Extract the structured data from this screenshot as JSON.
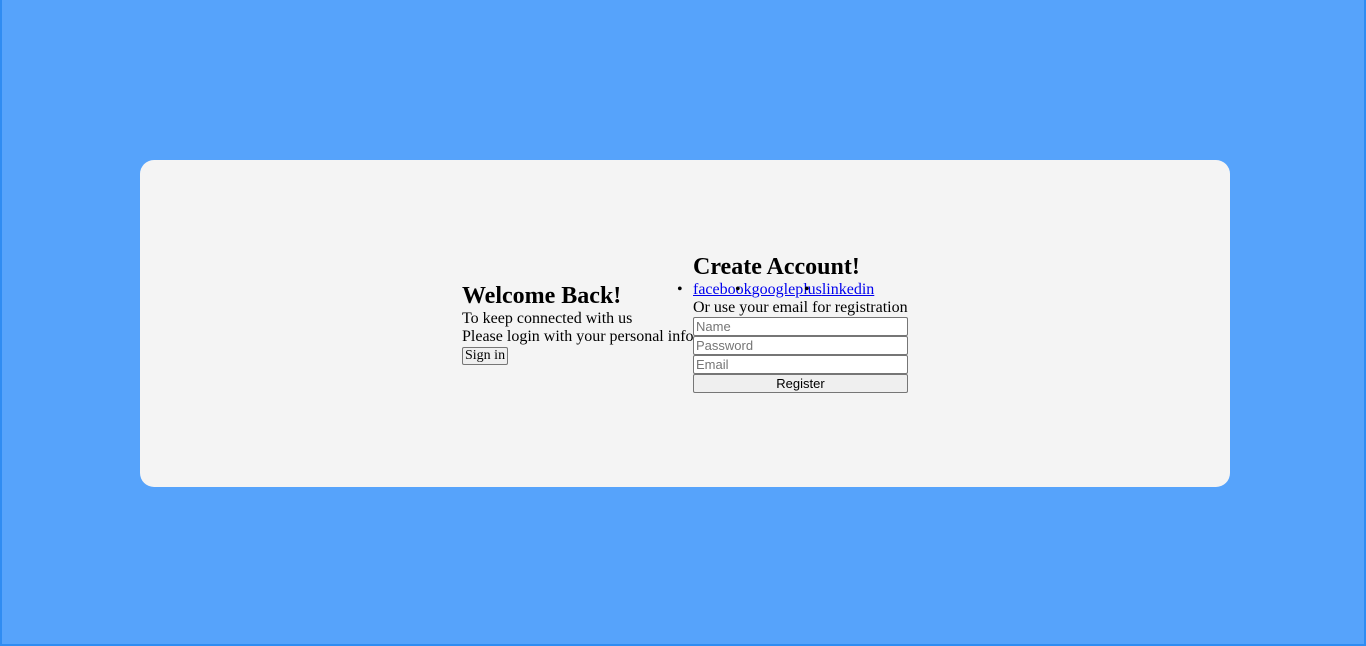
{
  "overlay": {
    "title": "Welcome Back!",
    "line1": "To keep connected with us",
    "line2": "Please login with your personal info",
    "signin_label": "Sign in"
  },
  "register_form": {
    "title": "Create Account!",
    "social": [
      "facebook",
      "googleplus",
      "linkedin"
    ],
    "note": "Or use your email for registration",
    "name_placeholder": "Name",
    "password_placeholder": "Password",
    "email_placeholder": "Email",
    "register_label": "Register"
  },
  "colors": {
    "background": "#56a3fb",
    "card": "#f4f4f4",
    "link": "#0000ee"
  }
}
